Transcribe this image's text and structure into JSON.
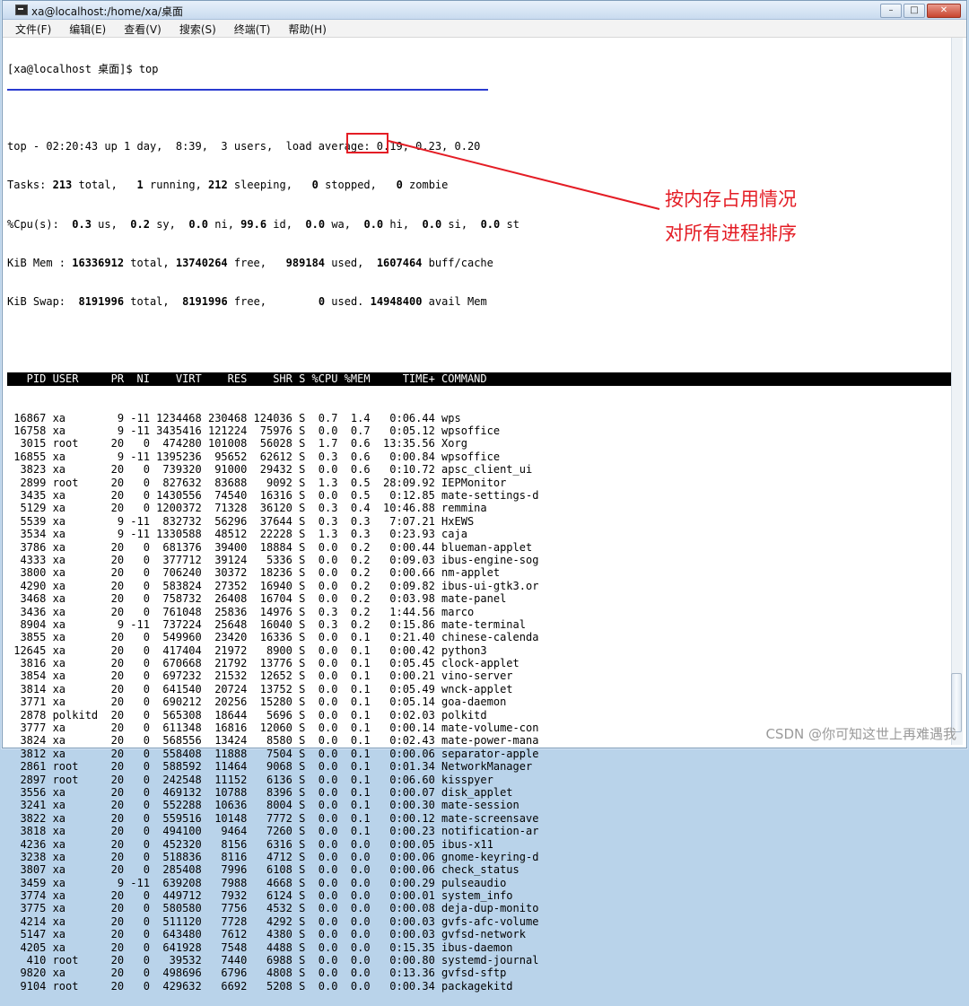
{
  "window": {
    "title": "xa@localhost:/home/xa/桌面",
    "buttons": {
      "minimize": "–",
      "maximize": "□",
      "close": "✕"
    }
  },
  "menu": [
    "文件(F)",
    "编辑(E)",
    "查看(V)",
    "搜索(S)",
    "终端(T)",
    "帮助(H)"
  ],
  "terminal": {
    "prompt": "[xa@localhost 桌面]$ top",
    "summary": {
      "line1": "top - 02:20:43 up 1 day,  8:39,  3 users,  load average: 0.19, 0.23, 0.20",
      "tasks": {
        "label": "Tasks:",
        "total": "213",
        "running": "1",
        "sleeping": "212",
        "stopped": "0",
        "zombie": "0"
      },
      "cpu": {
        "us": "0.3",
        "sy": "0.2",
        "ni": "0.0",
        "id": "99.6",
        "wa": "0.0",
        "hi": "0.0",
        "si": "0.0",
        "st": "0.0"
      },
      "mem": {
        "total": "16336912",
        "free": "13740264",
        "used": "989184",
        "buff_cache": "1607464"
      },
      "swap": {
        "total": "8191996",
        "free": "8191996",
        "used": "0",
        "avail": "14948400"
      }
    },
    "columns": [
      "PID",
      "USER",
      "PR",
      "NI",
      "VIRT",
      "RES",
      "SHR",
      "S",
      "%CPU",
      "%MEM",
      "TIME+",
      "COMMAND"
    ],
    "processes": [
      [
        "16867",
        "xa",
        "9",
        "-11",
        "1234468",
        "230468",
        "124036",
        "S",
        "0.7",
        "1.4",
        "0:06.44",
        "wps"
      ],
      [
        "16758",
        "xa",
        "9",
        "-11",
        "3435416",
        "121224",
        "75976",
        "S",
        "0.0",
        "0.7",
        "0:05.12",
        "wpsoffice"
      ],
      [
        "3015",
        "root",
        "20",
        "0",
        "474280",
        "101008",
        "56028",
        "S",
        "1.7",
        "0.6",
        "13:35.56",
        "Xorg"
      ],
      [
        "16855",
        "xa",
        "9",
        "-11",
        "1395236",
        "95652",
        "62612",
        "S",
        "0.3",
        "0.6",
        "0:00.84",
        "wpsoffice"
      ],
      [
        "3823",
        "xa",
        "20",
        "0",
        "739320",
        "91000",
        "29432",
        "S",
        "0.0",
        "0.6",
        "0:10.72",
        "apsc_client_ui"
      ],
      [
        "2899",
        "root",
        "20",
        "0",
        "827632",
        "83688",
        "9092",
        "S",
        "1.3",
        "0.5",
        "28:09.92",
        "IEPMonitor"
      ],
      [
        "3435",
        "xa",
        "20",
        "0",
        "1430556",
        "74540",
        "16316",
        "S",
        "0.0",
        "0.5",
        "0:12.85",
        "mate-settings-d"
      ],
      [
        "5129",
        "xa",
        "20",
        "0",
        "1200372",
        "71328",
        "36120",
        "S",
        "0.3",
        "0.4",
        "10:46.88",
        "remmina"
      ],
      [
        "5539",
        "xa",
        "9",
        "-11",
        "832732",
        "56296",
        "37644",
        "S",
        "0.3",
        "0.3",
        "7:07.21",
        "HxEWS"
      ],
      [
        "3534",
        "xa",
        "9",
        "-11",
        "1330588",
        "48512",
        "22228",
        "S",
        "1.3",
        "0.3",
        "0:23.93",
        "caja"
      ],
      [
        "3786",
        "xa",
        "20",
        "0",
        "681376",
        "39400",
        "18884",
        "S",
        "0.0",
        "0.2",
        "0:00.44",
        "blueman-applet"
      ],
      [
        "4333",
        "xa",
        "20",
        "0",
        "377712",
        "39124",
        "5336",
        "S",
        "0.0",
        "0.2",
        "0:09.03",
        "ibus-engine-sog"
      ],
      [
        "3800",
        "xa",
        "20",
        "0",
        "706240",
        "30372",
        "18236",
        "S",
        "0.0",
        "0.2",
        "0:00.66",
        "nm-applet"
      ],
      [
        "4290",
        "xa",
        "20",
        "0",
        "583824",
        "27352",
        "16940",
        "S",
        "0.0",
        "0.2",
        "0:09.82",
        "ibus-ui-gtk3.or"
      ],
      [
        "3468",
        "xa",
        "20",
        "0",
        "758732",
        "26408",
        "16704",
        "S",
        "0.0",
        "0.2",
        "0:03.98",
        "mate-panel"
      ],
      [
        "3436",
        "xa",
        "20",
        "0",
        "761048",
        "25836",
        "14976",
        "S",
        "0.3",
        "0.2",
        "1:44.56",
        "marco"
      ],
      [
        "8904",
        "xa",
        "9",
        "-11",
        "737224",
        "25648",
        "16040",
        "S",
        "0.3",
        "0.2",
        "0:15.86",
        "mate-terminal"
      ],
      [
        "3855",
        "xa",
        "20",
        "0",
        "549960",
        "23420",
        "16336",
        "S",
        "0.0",
        "0.1",
        "0:21.40",
        "chinese-calenda"
      ],
      [
        "12645",
        "xa",
        "20",
        "0",
        "417404",
        "21972",
        "8900",
        "S",
        "0.0",
        "0.1",
        "0:00.42",
        "python3"
      ],
      [
        "3816",
        "xa",
        "20",
        "0",
        "670668",
        "21792",
        "13776",
        "S",
        "0.0",
        "0.1",
        "0:05.45",
        "clock-applet"
      ],
      [
        "3854",
        "xa",
        "20",
        "0",
        "697232",
        "21532",
        "12652",
        "S",
        "0.0",
        "0.1",
        "0:00.21",
        "vino-server"
      ],
      [
        "3814",
        "xa",
        "20",
        "0",
        "641540",
        "20724",
        "13752",
        "S",
        "0.0",
        "0.1",
        "0:05.49",
        "wnck-applet"
      ],
      [
        "3771",
        "xa",
        "20",
        "0",
        "690212",
        "20256",
        "15280",
        "S",
        "0.0",
        "0.1",
        "0:05.14",
        "goa-daemon"
      ],
      [
        "2878",
        "polkitd",
        "20",
        "0",
        "565308",
        "18644",
        "5696",
        "S",
        "0.0",
        "0.1",
        "0:02.03",
        "polkitd"
      ],
      [
        "3777",
        "xa",
        "20",
        "0",
        "611348",
        "16816",
        "12060",
        "S",
        "0.0",
        "0.1",
        "0:00.14",
        "mate-volume-con"
      ],
      [
        "3824",
        "xa",
        "20",
        "0",
        "568556",
        "13424",
        "8580",
        "S",
        "0.0",
        "0.1",
        "0:02.43",
        "mate-power-mana"
      ],
      [
        "3812",
        "xa",
        "20",
        "0",
        "558408",
        "11888",
        "7504",
        "S",
        "0.0",
        "0.1",
        "0:00.06",
        "separator-apple"
      ],
      [
        "2861",
        "root",
        "20",
        "0",
        "588592",
        "11464",
        "9068",
        "S",
        "0.0",
        "0.1",
        "0:01.34",
        "NetworkManager"
      ],
      [
        "2897",
        "root",
        "20",
        "0",
        "242548",
        "11152",
        "6136",
        "S",
        "0.0",
        "0.1",
        "0:06.60",
        "kisspyer"
      ],
      [
        "3556",
        "xa",
        "20",
        "0",
        "469132",
        "10788",
        "8396",
        "S",
        "0.0",
        "0.1",
        "0:00.07",
        "disk_applet"
      ],
      [
        "3241",
        "xa",
        "20",
        "0",
        "552288",
        "10636",
        "8004",
        "S",
        "0.0",
        "0.1",
        "0:00.30",
        "mate-session"
      ],
      [
        "3822",
        "xa",
        "20",
        "0",
        "559516",
        "10148",
        "7772",
        "S",
        "0.0",
        "0.1",
        "0:00.12",
        "mate-screensave"
      ],
      [
        "3818",
        "xa",
        "20",
        "0",
        "494100",
        "9464",
        "7260",
        "S",
        "0.0",
        "0.1",
        "0:00.23",
        "notification-ar"
      ],
      [
        "4236",
        "xa",
        "20",
        "0",
        "452320",
        "8156",
        "6316",
        "S",
        "0.0",
        "0.0",
        "0:00.05",
        "ibus-x11"
      ],
      [
        "3238",
        "xa",
        "20",
        "0",
        "518836",
        "8116",
        "4712",
        "S",
        "0.0",
        "0.0",
        "0:00.06",
        "gnome-keyring-d"
      ],
      [
        "3807",
        "xa",
        "20",
        "0",
        "285408",
        "7996",
        "6108",
        "S",
        "0.0",
        "0.0",
        "0:00.06",
        "check_status"
      ],
      [
        "3459",
        "xa",
        "9",
        "-11",
        "639208",
        "7988",
        "4668",
        "S",
        "0.0",
        "0.0",
        "0:00.29",
        "pulseaudio"
      ],
      [
        "3774",
        "xa",
        "20",
        "0",
        "449712",
        "7932",
        "6124",
        "S",
        "0.0",
        "0.0",
        "0:00.01",
        "system_info"
      ],
      [
        "3775",
        "xa",
        "20",
        "0",
        "580580",
        "7756",
        "4532",
        "S",
        "0.0",
        "0.0",
        "0:00.08",
        "deja-dup-monito"
      ],
      [
        "4214",
        "xa",
        "20",
        "0",
        "511120",
        "7728",
        "4292",
        "S",
        "0.0",
        "0.0",
        "0:00.03",
        "gvfs-afc-volume"
      ],
      [
        "5147",
        "xa",
        "20",
        "0",
        "643480",
        "7612",
        "4380",
        "S",
        "0.0",
        "0.0",
        "0:00.03",
        "gvfsd-network"
      ],
      [
        "4205",
        "xa",
        "20",
        "0",
        "641928",
        "7548",
        "4488",
        "S",
        "0.0",
        "0.0",
        "0:15.35",
        "ibus-daemon"
      ],
      [
        "410",
        "root",
        "20",
        "0",
        "39532",
        "7440",
        "6988",
        "S",
        "0.0",
        "0.0",
        "0:00.80",
        "systemd-journal"
      ],
      [
        "9820",
        "xa",
        "20",
        "0",
        "498696",
        "6796",
        "4808",
        "S",
        "0.0",
        "0.0",
        "0:13.36",
        "gvfsd-sftp"
      ],
      [
        "9104",
        "root",
        "20",
        "0",
        "429632",
        "6692",
        "5208",
        "S",
        "0.0",
        "0.0",
        "0:00.34",
        "packagekitd"
      ]
    ]
  },
  "annotation": {
    "line1": "按内存占用情况",
    "line2": "对所有进程排序"
  },
  "watermark": "CSDN @你可知这世上再难遇我",
  "colors": {
    "annotation": "#e41d25",
    "underline": "#2a3bd0"
  }
}
